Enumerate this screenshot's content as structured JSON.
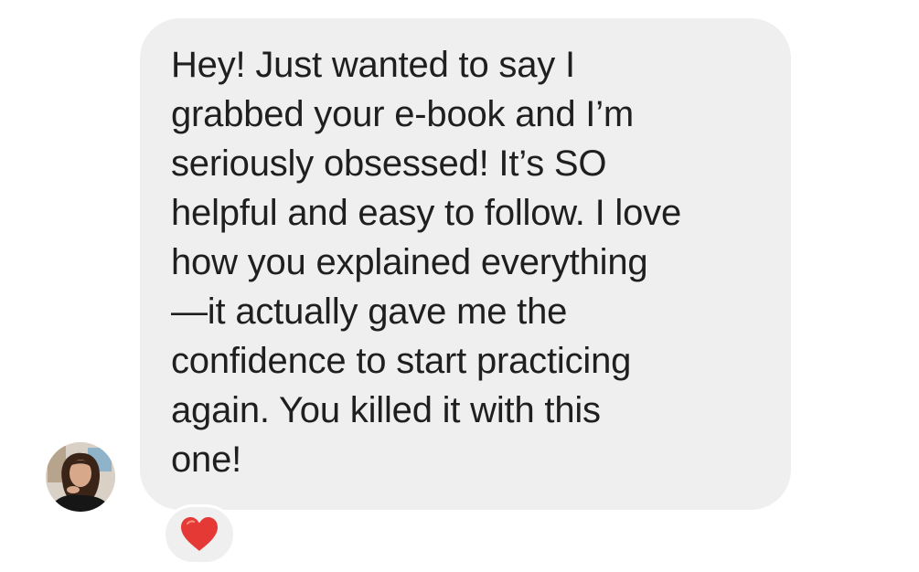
{
  "message": {
    "text": "Hey! Just wanted to say I\ngrabbed your e-book and I’m\nseriously obsessed! It’s SO\nhelpful and easy to follow. I love\nhow you explained everything\n—it actually gave me the\nconfidence to start practicing\nagain. You killed it with this\none!",
    "bubble_color": "#efefef",
    "text_color": "#1f1f1f"
  },
  "avatar": {
    "icon": "profile-photo"
  },
  "reaction": {
    "icon": "red-heart-emoji",
    "color": "#e53935"
  }
}
